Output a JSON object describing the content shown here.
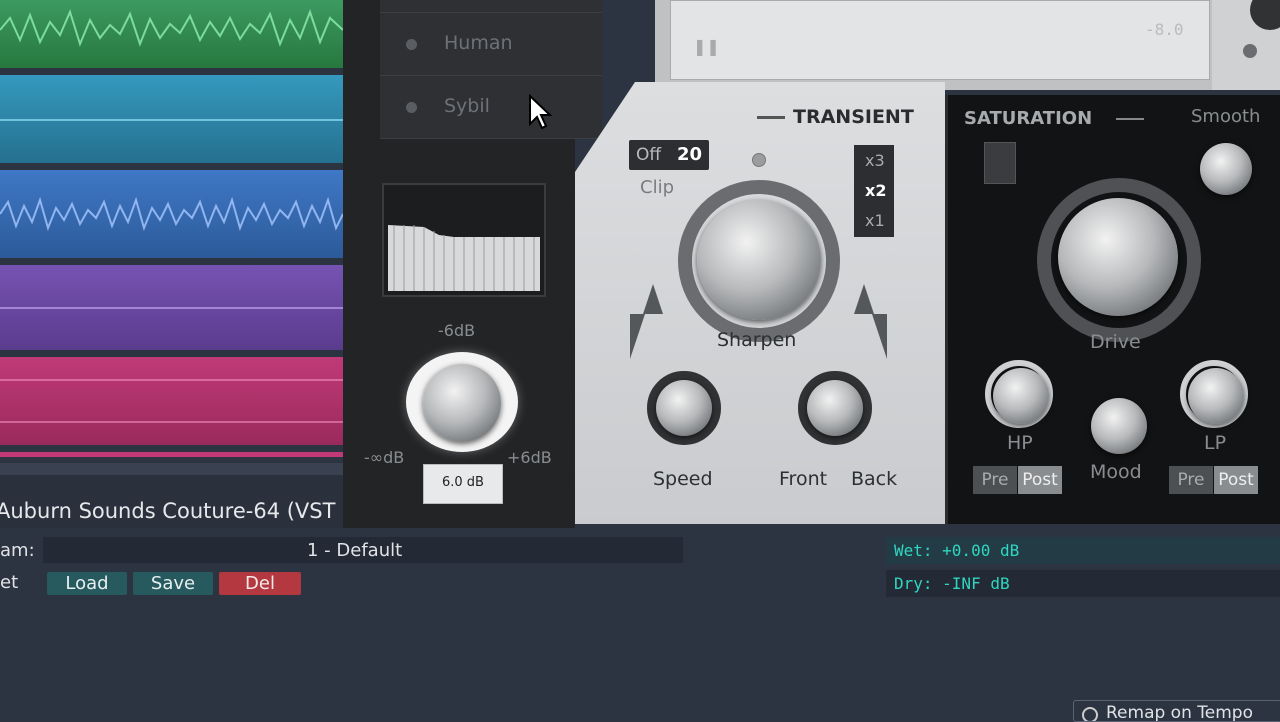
{
  "plugin": {
    "title": "Auburn Sounds Couture-64 (VST",
    "presets": [
      "Human",
      "Sybil"
    ],
    "transient": {
      "section_title": "TRANSIENT",
      "clip_off": "Off",
      "clip_value": "20",
      "clip_label": "Clip",
      "oversample": [
        "x3",
        "x2",
        "x1"
      ],
      "selected_oversample": "x2",
      "main_knob_label": "Sharpen",
      "speed_label": "Speed",
      "front_label": "Front",
      "back_label": "Back"
    },
    "saturation": {
      "section_title": "SATURATION",
      "smooth_label": "Smooth",
      "drive_label": "Drive",
      "hp_label": "HP",
      "lp_label": "LP",
      "mood_label": "Mood",
      "pre": "Pre",
      "post": "Post"
    },
    "output": {
      "top_label": "-6dB",
      "min_label": "-∞dB",
      "max_label": "+6dB",
      "value": "6.0 dB"
    },
    "meter": {
      "value": "-8.0"
    }
  },
  "bottom": {
    "param_label": "am:",
    "preset_value": "1 - Default",
    "preset_label": "et",
    "load": "Load",
    "save": "Save",
    "del": "Del",
    "wet": "Wet: +0.00 dB",
    "dry": "Dry: -INF dB",
    "remap": "Remap on Tempo"
  },
  "colors": {
    "track_green": "#2f8a52",
    "track_teal": "#2a83a6",
    "track_blue": "#3467b0",
    "track_purple": "#6a4aa6",
    "track_pink": "#b3336e",
    "wet_text": "#2fd6c0",
    "del_red": "#b3383f",
    "btn_teal": "#265a5e"
  }
}
